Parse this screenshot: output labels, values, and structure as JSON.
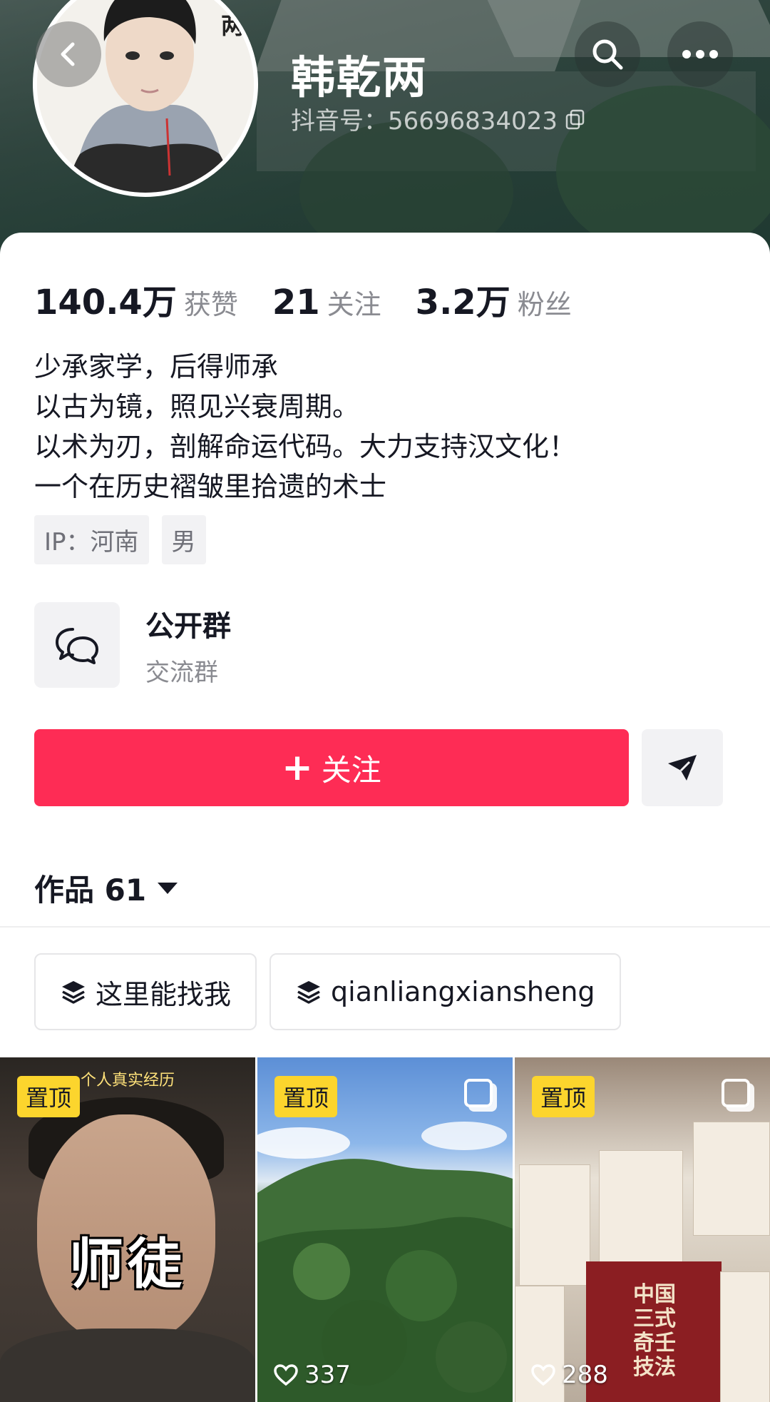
{
  "profile": {
    "nickname": "韩乾两",
    "douyin_id": "抖音号：56696834023",
    "avatar_text": "乾两"
  },
  "stats": [
    {
      "value": "140.4万",
      "label": "获赞"
    },
    {
      "value": "21",
      "label": "关注"
    },
    {
      "value": "3.2万",
      "label": "粉丝"
    }
  ],
  "bio": [
    "少承家学，后得师承",
    "以古为镜，照见兴衰周期。",
    "以术为刃，剖解命运代码。大力支持汉文化！",
    "一个在历史褶皱里拾遗的术士"
  ],
  "tags": [
    "IP：河南",
    "男"
  ],
  "group": {
    "title": "公开群",
    "subtitle": "交流群",
    "icon": "chat-bubbles-icon"
  },
  "actions": {
    "follow_label": "关注",
    "follow_color": "#fe2c55",
    "share_icon": "send-icon"
  },
  "works": {
    "label": "作品 61"
  },
  "chips": [
    {
      "label": "这里能找我",
      "icon": "stack-icon"
    },
    {
      "label": "qianliangxiansheng",
      "icon": "stack-icon"
    }
  ],
  "videos": [
    {
      "pinned_label": "置顶",
      "caption": "个人真实经历",
      "title": "师徒",
      "likes": "",
      "multi_image": false
    },
    {
      "pinned_label": "置顶",
      "likes": "337",
      "multi_image": true
    },
    {
      "pinned_label": "置顶",
      "likes": "288",
      "multi_image": true,
      "book_titles": [
        "中国三式奇壬技法"
      ]
    }
  ]
}
